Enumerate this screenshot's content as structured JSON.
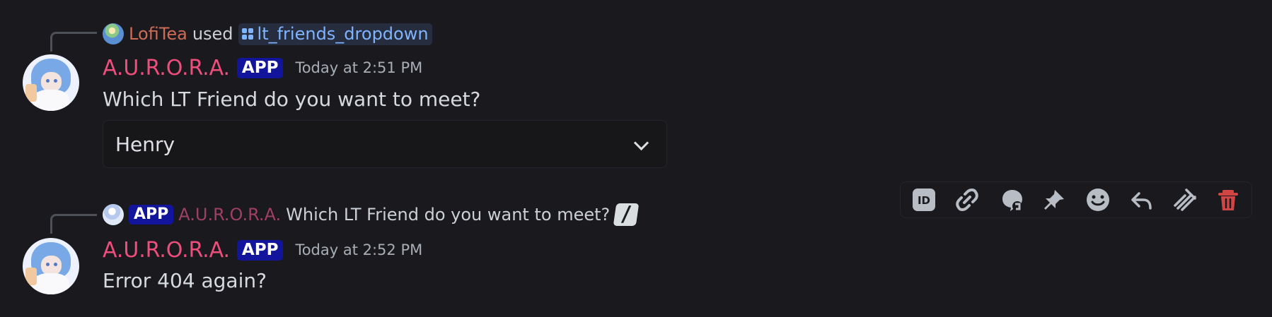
{
  "messages": [
    {
      "reply": {
        "user": "LofiTea",
        "verb": "used",
        "command": "lt_friends_dropdown"
      },
      "author": "A.U.R.O.R.A.",
      "badge": "APP",
      "timestamp": "Today at 2:51 PM",
      "content": "Which LT Friend do you want to meet?",
      "dropdown": {
        "selected": "Henry"
      }
    },
    {
      "reply": {
        "badge": "APP",
        "author": "A.U.R.O.R.A.",
        "text": "Which LT Friend do you want to meet?",
        "slash_glyph": "/"
      },
      "author": "A.U.R.O.R.A.",
      "badge": "APP",
      "timestamp": "Today at 2:52 PM",
      "content": "Error 404 again?"
    }
  ],
  "toolbar": {
    "icons": [
      "id-icon",
      "link-icon",
      "thread-reply-icon",
      "pin-icon",
      "emoji-icon",
      "reply-icon",
      "bookmark-icon",
      "trash-icon"
    ]
  },
  "colors": {
    "background": "#1a1a1e",
    "author": "#ef4e7c",
    "app_badge": "#12149b",
    "command_link": "#7fb4ff",
    "delete": "#d24545"
  }
}
